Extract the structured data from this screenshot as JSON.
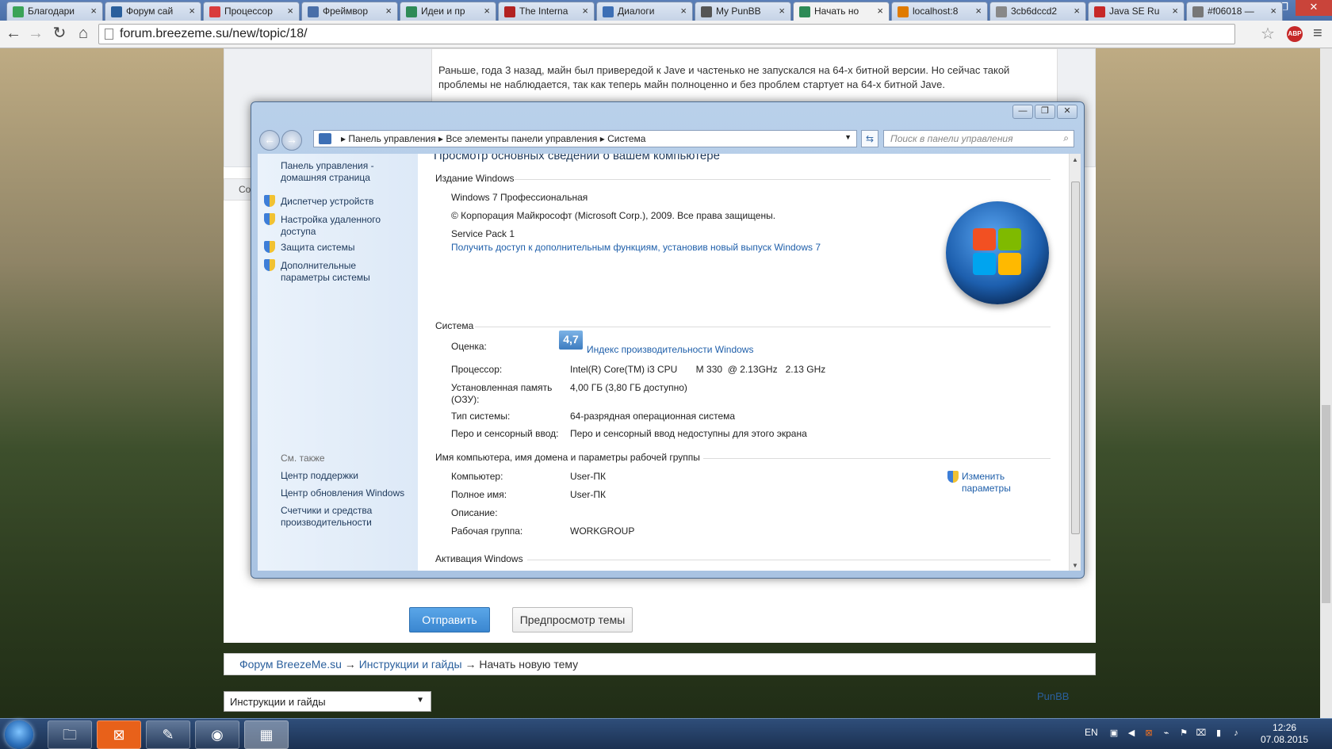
{
  "browser": {
    "tabs": [
      {
        "title": "Благодари",
        "color": "#3aa357"
      },
      {
        "title": "Форум сай",
        "color": "#2a5f9c"
      },
      {
        "title": "Процессор",
        "color": "#d93c3c"
      },
      {
        "title": "Фреймвор",
        "color": "#4a6fa8"
      },
      {
        "title": "Идеи и пр",
        "color": "#2e8b57"
      },
      {
        "title": "The Interna",
        "color": "#b22222"
      },
      {
        "title": "Диалоги",
        "color": "#3d6fb5"
      },
      {
        "title": "My PunBB",
        "color": "#555555"
      },
      {
        "title": "Начать но",
        "color": "#2e8b57"
      },
      {
        "title": "localhost:8",
        "color": "#e07b00"
      },
      {
        "title": "3cb6dccd2",
        "color": "#888888"
      },
      {
        "title": "Java SE Ru",
        "color": "#c62828"
      },
      {
        "title": "#f06018 —",
        "color": "#777777"
      }
    ],
    "close_glyph": "×",
    "url": "forum.breezeme.su/new/topic/18/",
    "abp": "ABP",
    "win_min": "—",
    "win_max": "❐",
    "win_close": "✕"
  },
  "forum": {
    "post_text": "Раньше, года 3 назад, майн был привередой к Jave и частенько не запускался на 64-х битной версии. Но сейчас такой проблемы не наблюдается, так как теперь майн полноценно и без проблем стартует на 64-х битной Jave.",
    "side_tab": "Со",
    "send_button": "Отправить",
    "preview_button": "Предпросмотр темы",
    "breadcrumb": {
      "home": "Форум BreezeMe.su",
      "arrow": "→",
      "section": "Инструкции и гайды",
      "current": "Начать новую тему"
    },
    "jump_select": "Инструкции и гайды",
    "powered": "PunBB"
  },
  "explorer": {
    "address": [
      "Панель управления",
      "Все элементы панели управления",
      "Система"
    ],
    "search_placeholder": "Поиск в панели управления",
    "nav": {
      "home": "Панель управления - домашняя страница",
      "links": [
        "Диспетчер устройств",
        "Настройка удаленного доступа",
        "Защита системы",
        "Дополнительные параметры системы"
      ],
      "see_also": "См. также",
      "also_links": [
        "Центр поддержки",
        "Центр обновления Windows",
        "Счетчики и средства производительности"
      ]
    },
    "page_heading": "Просмотр основных сведений о вашем компьютере",
    "edition": {
      "header": "Издание Windows",
      "name": "Windows 7 Профессиональная",
      "copyright": "© Корпорация Майкрософт (Microsoft Corp.), 2009. Все права защищены.",
      "sp": "Service Pack 1",
      "upgrade_link": "Получить доступ к дополнительным функциям, установив новый выпуск Windows 7"
    },
    "system": {
      "header": "Система",
      "rating_label": "Оценка:",
      "rating_value": "4,7",
      "rating_link": "Индекс производительности Windows",
      "cpu_label": "Процессор:",
      "cpu_value": "Intel(R) Core(TM) i3 CPU       M 330  @ 2.13GHz   2.13 GHz",
      "ram_label": "Установленная память (ОЗУ):",
      "ram_value": "4,00 ГБ (3,80 ГБ доступно)",
      "type_label": "Тип системы:",
      "type_value": "64-разрядная операционная система",
      "pen_label": "Перо и сенсорный ввод:",
      "pen_value": "Перо и сенсорный ввод недоступны для этого экрана"
    },
    "computer": {
      "header": "Имя компьютера, имя домена и параметры рабочей группы",
      "name_label": "Компьютер:",
      "name_value": "User-ПК",
      "full_label": "Полное имя:",
      "full_value": "User-ПК",
      "desc_label": "Описание:",
      "wg_label": "Рабочая группа:",
      "wg_value": "WORKGROUP",
      "change_link": "Изменить параметры"
    },
    "activation_header": "Активация Windows"
  },
  "taskbar": {
    "lang": "EN",
    "time": "12:26",
    "date": "07.08.2015"
  }
}
